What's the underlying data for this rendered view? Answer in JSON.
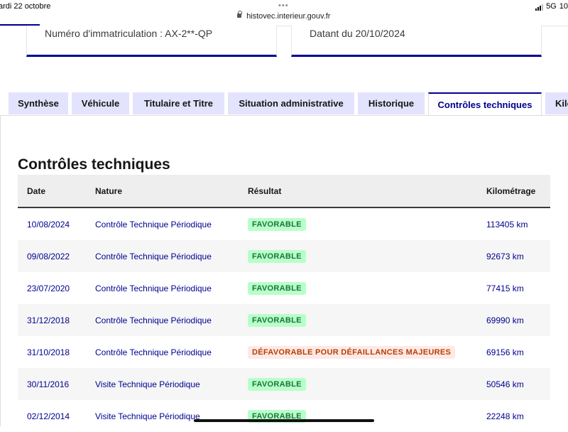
{
  "status_bar": {
    "date": "ardi 22 octobre",
    "url": "histovec.interieur.gouv.fr",
    "network": "5G",
    "time_fragment": "10"
  },
  "cards": {
    "registration": "Numéro d'immatriculation : AX-2**-QP",
    "dated": "Datant du 20/10/2024"
  },
  "tabs": [
    {
      "label": "Synthèse"
    },
    {
      "label": "Véhicule"
    },
    {
      "label": "Titulaire et Titre"
    },
    {
      "label": "Situation administrative"
    },
    {
      "label": "Historique"
    },
    {
      "label": "Contrôles techniques"
    },
    {
      "label": "Kilo"
    }
  ],
  "section": {
    "title": "Contrôles techniques"
  },
  "table": {
    "headers": [
      "Date",
      "Nature",
      "Résultat",
      "Kilométrage"
    ],
    "rows": [
      {
        "date": "10/08/2024",
        "nature": "Contrôle Technique Périodique",
        "result": "FAVORABLE",
        "km": "113405 km"
      },
      {
        "date": "09/08/2022",
        "nature": "Contrôle Technique Périodique",
        "result": "FAVORABLE",
        "km": "92673 km"
      },
      {
        "date": "23/07/2020",
        "nature": "Contrôle Technique Périodique",
        "result": "FAVORABLE",
        "km": "77415 km"
      },
      {
        "date": "31/12/2018",
        "nature": "Contrôle Technique Périodique",
        "result": "FAVORABLE",
        "km": "69990 km"
      },
      {
        "date": "31/10/2018",
        "nature": "Contrôle Technique Périodique",
        "result": "DÉFAVORABLE POUR DÉFAILLANCES MAJEURES",
        "km": "69156 km"
      },
      {
        "date": "30/11/2016",
        "nature": "Visite Technique Périodique",
        "result": "FAVORABLE",
        "km": "50546 km"
      },
      {
        "date": "02/12/2014",
        "nature": "Visite Technique Périodique",
        "result": "FAVORABLE",
        "km": "22248 km"
      }
    ]
  },
  "colors": {
    "accent": "#000091",
    "favorable_bg": "#b8fec9",
    "favorable_text": "#18753c",
    "defavorable_bg": "#ffe9e6",
    "defavorable_text": "#b34000",
    "tab_bg": "#e3e3fd"
  }
}
